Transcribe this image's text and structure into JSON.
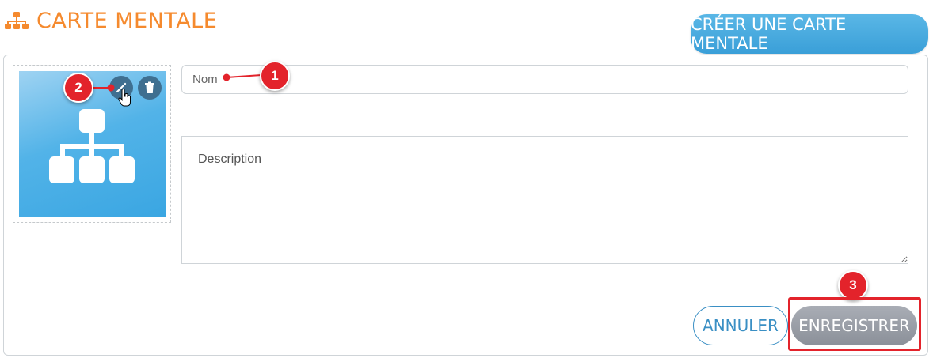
{
  "header": {
    "title": "CARTE MENTALE",
    "title_icon": "sitemap-icon",
    "create_button_label": "CRÉER UNE CARTE MENTALE"
  },
  "form": {
    "image": {
      "icon": "sitemap-icon",
      "edit_icon": "pencil-icon",
      "delete_icon": "trash-icon"
    },
    "name_placeholder": "Nom",
    "description_placeholder": "Description",
    "cancel_label": "ANNULER",
    "save_label": "ENREGISTRER"
  },
  "annotations": {
    "step1": "1",
    "step2": "2",
    "step3": "3"
  },
  "colors": {
    "title": "#f58a2e",
    "primary": "#3aa1d9",
    "annotation": "#e3232b",
    "save_disabled": "#9a9ea6"
  }
}
